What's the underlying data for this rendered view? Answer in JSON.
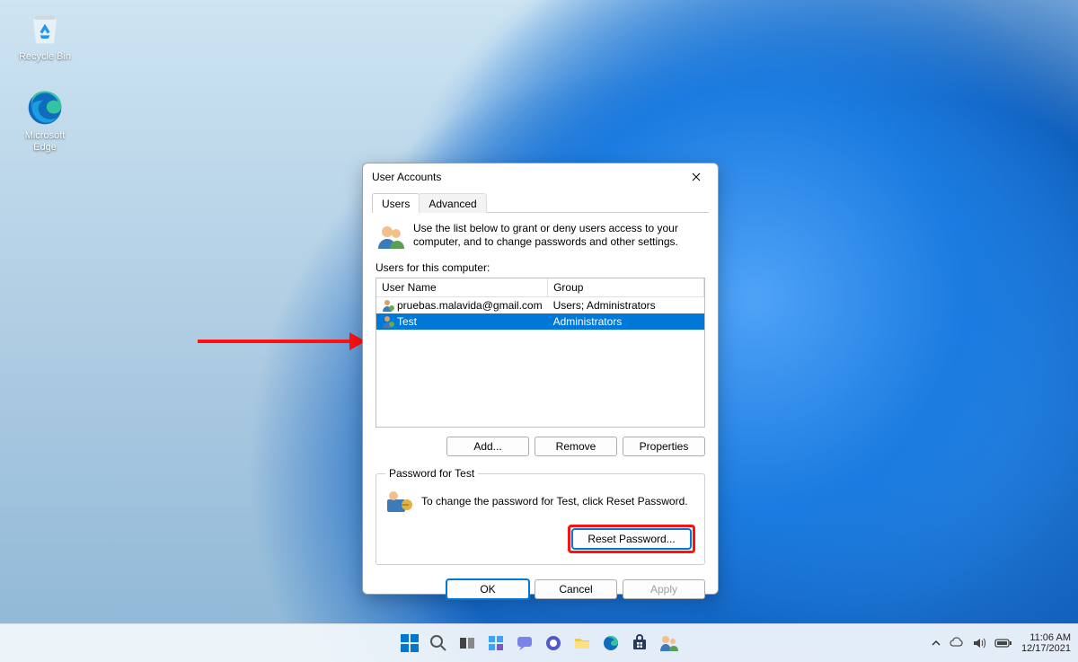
{
  "desktop": {
    "icons": [
      {
        "name": "recycle-bin",
        "label": "Recycle Bin"
      },
      {
        "name": "microsoft-edge",
        "label": "Microsoft Edge"
      }
    ]
  },
  "dialog": {
    "title": "User Accounts",
    "tabs": {
      "users": "Users",
      "advanced": "Advanced"
    },
    "intro": "Use the list below to grant or deny users access to your computer, and to change passwords and other settings.",
    "users_label": "Users for this computer:",
    "columns": {
      "username": "User Name",
      "group": "Group"
    },
    "rows": [
      {
        "username": "pruebas.malavida@gmail.com",
        "group": "Users; Administrators",
        "selected": false
      },
      {
        "username": "Test",
        "group": "Administrators",
        "selected": true
      }
    ],
    "buttons": {
      "add": "Add...",
      "remove": "Remove",
      "properties": "Properties"
    },
    "password_group": {
      "legend": "Password for Test",
      "text": "To change the password for Test, click Reset Password.",
      "reset": "Reset Password..."
    },
    "footer": {
      "ok": "OK",
      "cancel": "Cancel",
      "apply": "Apply"
    }
  },
  "taskbar": {
    "items": [
      "start",
      "search",
      "task-view",
      "widgets",
      "chat",
      "teams",
      "file-explorer",
      "edge",
      "microsoft-store",
      "user-accounts"
    ]
  },
  "tray": {
    "time": "11:06 AM",
    "date": "12/17/2021"
  }
}
